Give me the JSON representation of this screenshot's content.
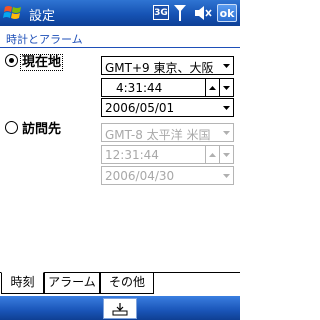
{
  "titlebar": {
    "title": "設定",
    "network_badge": "3G",
    "ok_label": "ok"
  },
  "page": {
    "title": "時計とアラーム"
  },
  "home": {
    "radio_label": "現在地",
    "selected": true,
    "timezone": "GMT+9 東京、大阪",
    "time": "4:31:44",
    "date": "2006/05/01"
  },
  "visiting": {
    "radio_label": "訪問先",
    "selected": false,
    "timezone": "GMT-8 太平洋 米国",
    "time": "12:31:44",
    "date": "2006/04/30"
  },
  "tabs": [
    {
      "label": "時刻",
      "active": true
    },
    {
      "label": "アラーム",
      "active": false
    },
    {
      "label": "その他",
      "active": false
    }
  ],
  "icons": {
    "start": "windows-start-icon",
    "signal": "signal-strength-icon",
    "volume": "speaker-muted-icon",
    "keyboard": "keyboard-icon"
  },
  "colors": {
    "titlebar": "#1653b4",
    "heading": "#1e4fb8",
    "disabled_text": "#a8a8a8"
  }
}
